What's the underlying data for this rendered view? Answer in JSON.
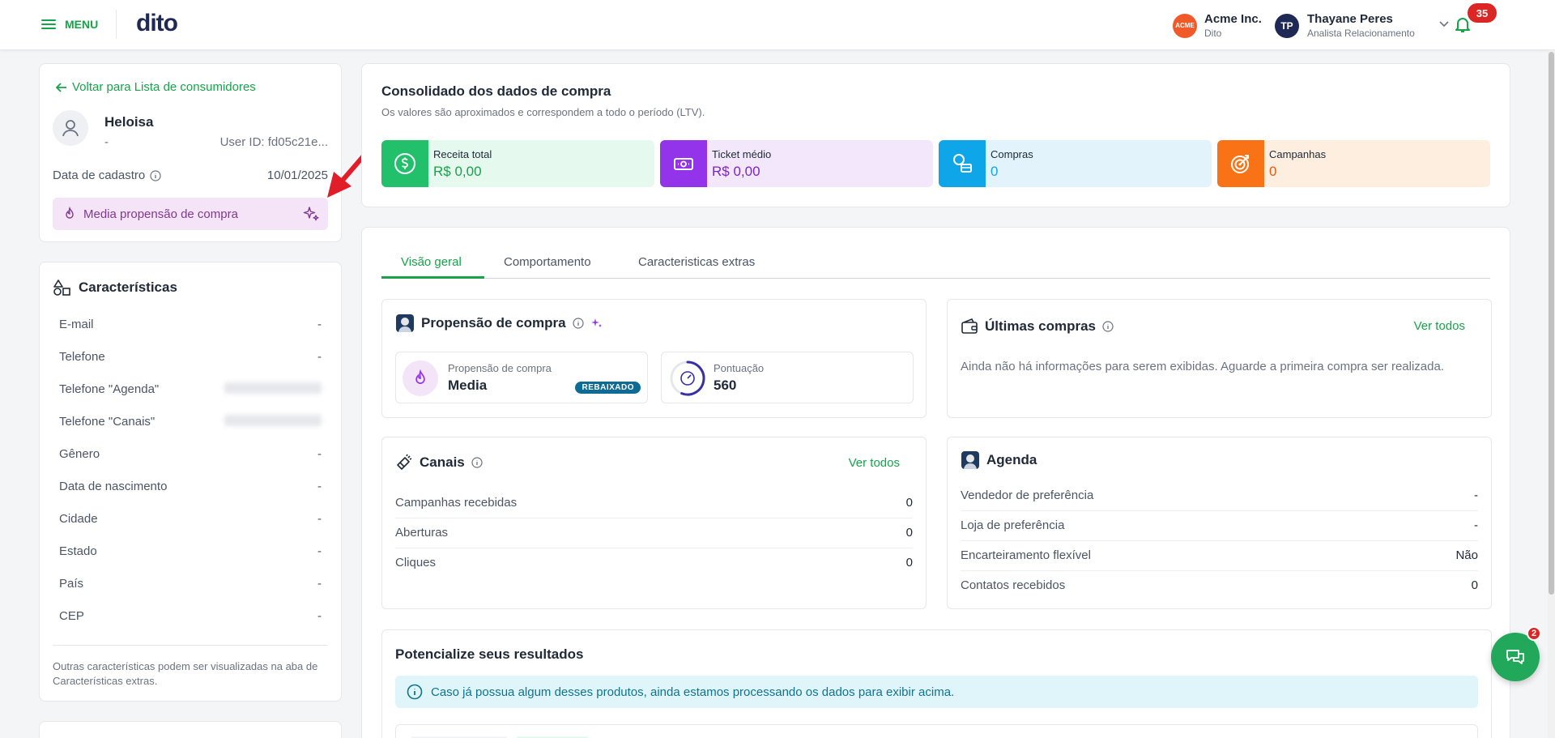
{
  "header": {
    "menu_label": "MENU",
    "logo_text": "dito",
    "org": {
      "logo_text": "ACME",
      "name": "Acme Inc.",
      "sub": "Dito"
    },
    "user": {
      "initials": "TP",
      "name": "Thayane Peres",
      "role": "Analista Relacionamento"
    },
    "notifications_count": "35"
  },
  "profile": {
    "back_link": "Voltar para Lista de consumidores",
    "name": "Heloisa",
    "subtitle": "-",
    "user_id": "User ID: fd05c21e...",
    "registration_label": "Data de cadastro",
    "registration_date": "10/01/2025",
    "propensity_pill": "Media propensão de compra"
  },
  "characteristics": {
    "title": "Características",
    "rows": [
      {
        "label": "E-mail",
        "value": "-"
      },
      {
        "label": "Telefone",
        "value": "-"
      },
      {
        "label": "Telefone \"Agenda\"",
        "value": ""
      },
      {
        "label": "Telefone \"Canais\"",
        "value": ""
      },
      {
        "label": "Gênero",
        "value": "-"
      },
      {
        "label": "Data de nascimento",
        "value": "-"
      },
      {
        "label": "Cidade",
        "value": "-"
      },
      {
        "label": "Estado",
        "value": "-"
      },
      {
        "label": "País",
        "value": "-"
      },
      {
        "label": "CEP",
        "value": "-"
      }
    ],
    "note": "Outras características podem ser visualizadas na aba de Características extras."
  },
  "consolidado": {
    "title": "Consolidado dos dados de compra",
    "subtitle": "Os valores são aproximados e correspondem a todo o período (LTV).",
    "kpis": [
      {
        "label": "Receita total",
        "value": "R$ 0,00",
        "color": "#16a34a",
        "bg": "#e6f9ef",
        "icon": "dollar-coin-icon"
      },
      {
        "label": "Ticket médio",
        "value": "R$ 0,00",
        "color": "#7e22ce",
        "bg": "#f3e8fb",
        "icon": "money-bill-icon"
      },
      {
        "label": "Compras",
        "value": "0",
        "color": "#0ea5e9",
        "bg": "#e2f3fb",
        "icon": "coins-card-icon"
      },
      {
        "label": "Campanhas",
        "value": "0",
        "color": "#ea580c",
        "bg": "#fdeedf",
        "icon": "target-icon"
      }
    ]
  },
  "tabs": [
    {
      "label": "Visão geral",
      "active": true
    },
    {
      "label": "Comportamento",
      "active": false
    },
    {
      "label": "Caracteristicas extras",
      "active": false
    }
  ],
  "propensao": {
    "title": "Propensão de compra",
    "card1_label": "Propensão de compra",
    "card1_value": "Media",
    "card1_badge": "REBAIXADO",
    "card2_label": "Pontuação",
    "card2_value": "560",
    "score_fraction": 0.56
  },
  "ultimas": {
    "title": "Últimas compras",
    "link": "Ver todos",
    "empty": "Ainda não há informações para serem exibidas. Aguarde a primeira compra ser realizada."
  },
  "canais": {
    "title": "Canais",
    "link": "Ver todos",
    "rows": [
      {
        "label": "Campanhas recebidas",
        "value": "0"
      },
      {
        "label": "Aberturas",
        "value": "0"
      },
      {
        "label": "Cliques",
        "value": "0"
      }
    ]
  },
  "agenda": {
    "title": "Agenda",
    "rows": [
      {
        "label": "Vendedor de preferência",
        "value": "-"
      },
      {
        "label": "Loja de preferência",
        "value": "-"
      },
      {
        "label": "Encarteiramento flexível",
        "value": "Não"
      },
      {
        "label": "Contatos recebidos",
        "value": "0"
      }
    ]
  },
  "potencialize": {
    "title": "Potencialize seus resultados",
    "info": "Caso já possua algum desses produtos, ainda estamos processando os dados para exibir acima."
  },
  "chat": {
    "badge": "2"
  }
}
